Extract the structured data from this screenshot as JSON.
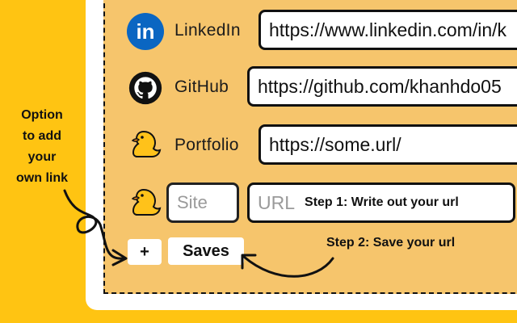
{
  "rows": [
    {
      "label": "LinkedIn",
      "url": "https://www.linkedin.com/in/k",
      "icon": "linkedin-icon"
    },
    {
      "label": "GitHub",
      "url": "https://github.com/khanhdo05",
      "icon": "github-icon"
    },
    {
      "label": "Portfolio",
      "url": "https://some.url/",
      "icon": "duck-icon"
    }
  ],
  "custom_row": {
    "site_placeholder": "Site",
    "url_placeholder": "URL",
    "icon": "duck-icon"
  },
  "buttons": {
    "add_label": "+",
    "save_label": "Saves"
  },
  "annotations": {
    "option_line1": "Option",
    "option_line2": "to add",
    "option_line3": "your",
    "option_line4": "own link",
    "step1": "Step 1: Write out your url",
    "step2": "Step 2: Save your url"
  },
  "colors": {
    "background": "#ffc412",
    "panel": "#f6c56c",
    "linkedin": "#0a66c2"
  }
}
